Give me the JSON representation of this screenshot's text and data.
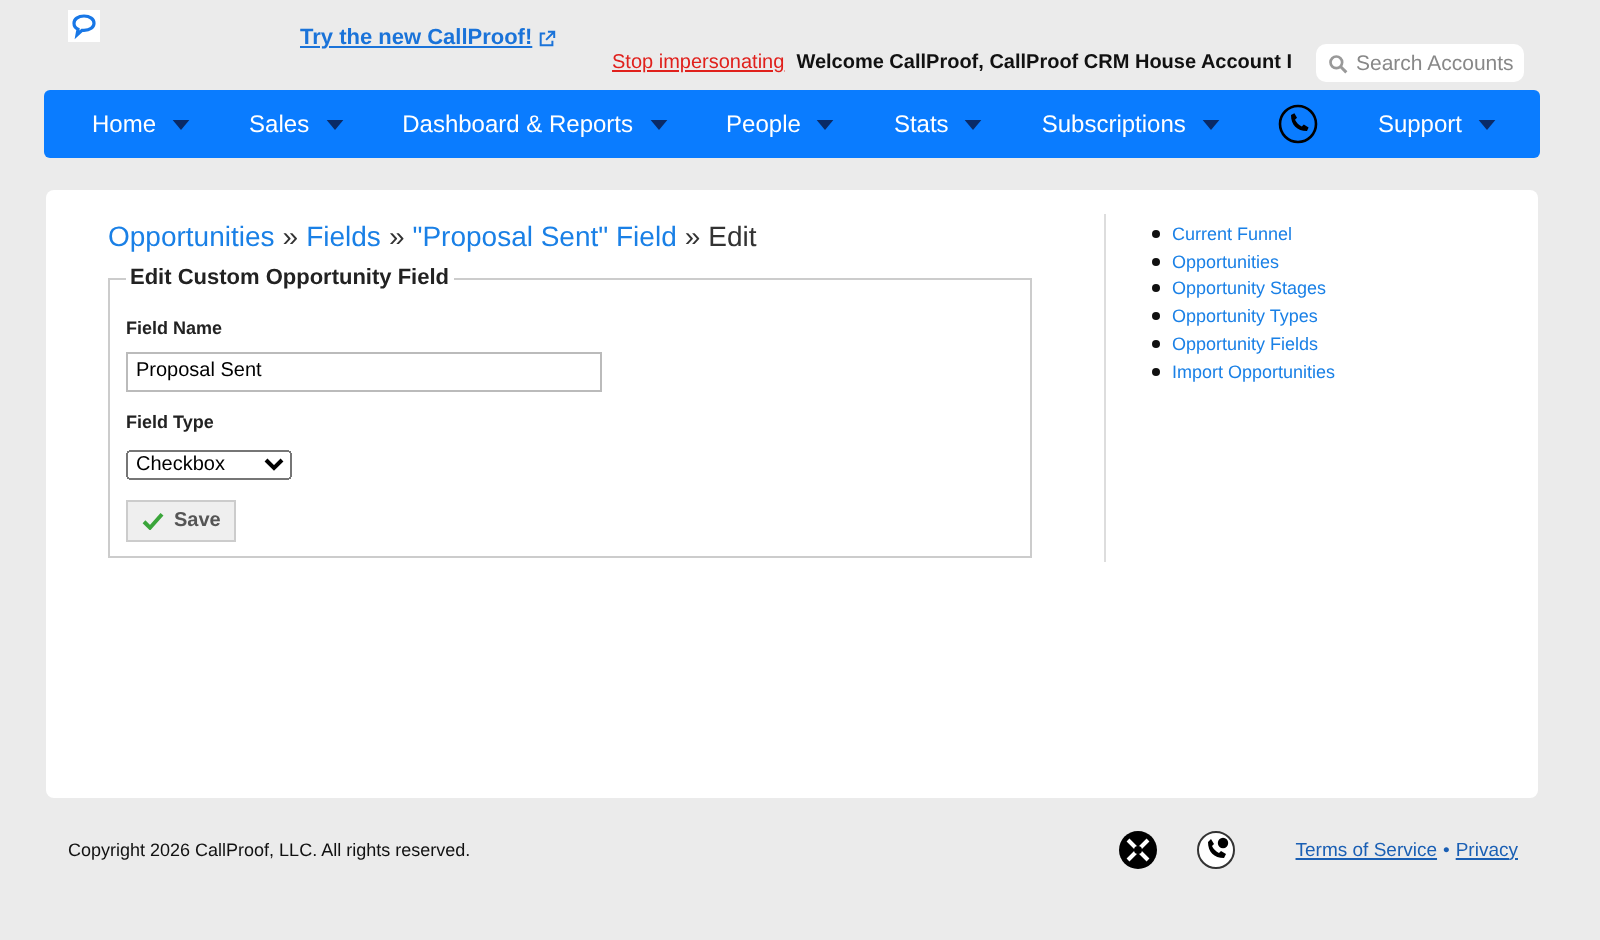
{
  "header": {
    "try_link": "Try the new CallProof!",
    "stop_link": "Stop impersonating",
    "welcome": "Welcome CallProof, CallProof CRM House Account I",
    "search": {
      "placeholder": "Search Accounts"
    }
  },
  "nav": [
    {
      "kind": "dropdown",
      "label": "Home"
    },
    {
      "kind": "dropdown",
      "label": "Sales"
    },
    {
      "kind": "dropdown",
      "label": "Dashboard & Reports"
    },
    {
      "kind": "dropdown",
      "label": "People"
    },
    {
      "kind": "dropdown",
      "label": "Stats"
    },
    {
      "kind": "dropdown",
      "label": "Subscriptions"
    },
    {
      "kind": "phone"
    },
    {
      "kind": "dropdown",
      "label": "Support"
    }
  ],
  "breadcrumb": [
    {
      "label": "Opportunities",
      "link": true
    },
    {
      "label": "»",
      "link": false
    },
    {
      "label": "Fields",
      "link": true
    },
    {
      "label": "»",
      "link": false
    },
    {
      "label": "\"Proposal Sent\" Field",
      "link": true
    },
    {
      "label": "»",
      "link": false
    },
    {
      "label": "Edit",
      "link": false
    }
  ],
  "form": {
    "legend": "Edit Custom Opportunity Field",
    "name_label": "Field Name",
    "name_value": "Proposal Sent",
    "type_label": "Field Type",
    "type_value": "Checkbox",
    "save": "Save"
  },
  "sidebar": {
    "items": [
      "Current Funnel",
      "Opportunities",
      "Opportunity Stages",
      "Opportunity Types",
      "Opportunity Fields",
      "Import Opportunities"
    ]
  },
  "footer": {
    "copyright": "Copyright 2026 CallProof, LLC. All rights reserved.",
    "links": [
      "Terms of Service",
      "Privacy"
    ],
    "separator": "•"
  }
}
